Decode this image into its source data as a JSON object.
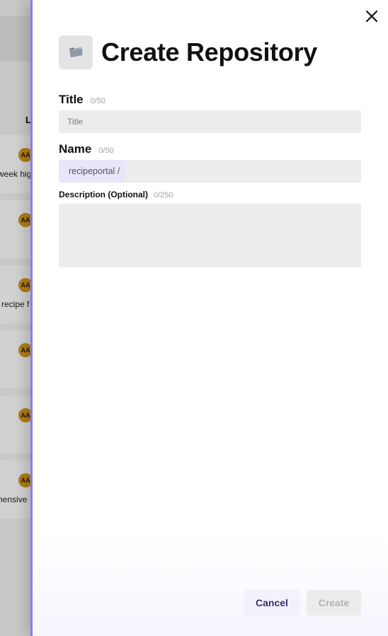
{
  "background": {
    "column_label": "L",
    "rows": [
      {
        "avatar": "AA",
        "text": "week hig"
      },
      {
        "avatar": "AA",
        "text": ""
      },
      {
        "avatar": "AA",
        "text": "recipe f"
      },
      {
        "avatar": "AA",
        "text": ""
      },
      {
        "avatar": "AA",
        "text": ""
      },
      {
        "avatar": "AA",
        "text": "hensive"
      }
    ]
  },
  "drawer": {
    "title": "Create Repository",
    "header_icon": "folder-icon",
    "close_icon": "close-icon",
    "fields": {
      "title": {
        "label": "Title",
        "counter": "0/50",
        "value": "",
        "placeholder": "Title"
      },
      "name": {
        "label": "Name",
        "counter": "0/50",
        "prefix": "recipeportal /",
        "value": "",
        "placeholder": ""
      },
      "description": {
        "label": "Description (Optional)",
        "counter": "0/250",
        "value": "",
        "placeholder": ""
      }
    },
    "buttons": {
      "cancel": "Cancel",
      "create": "Create",
      "create_disabled": true
    }
  },
  "colors": {
    "accent": "#8b7de8",
    "avatar": "#d79a1a",
    "input_bg": "#ececec",
    "prefix_bg": "#e9e6fb",
    "cancel_text": "#3a2f6e"
  }
}
